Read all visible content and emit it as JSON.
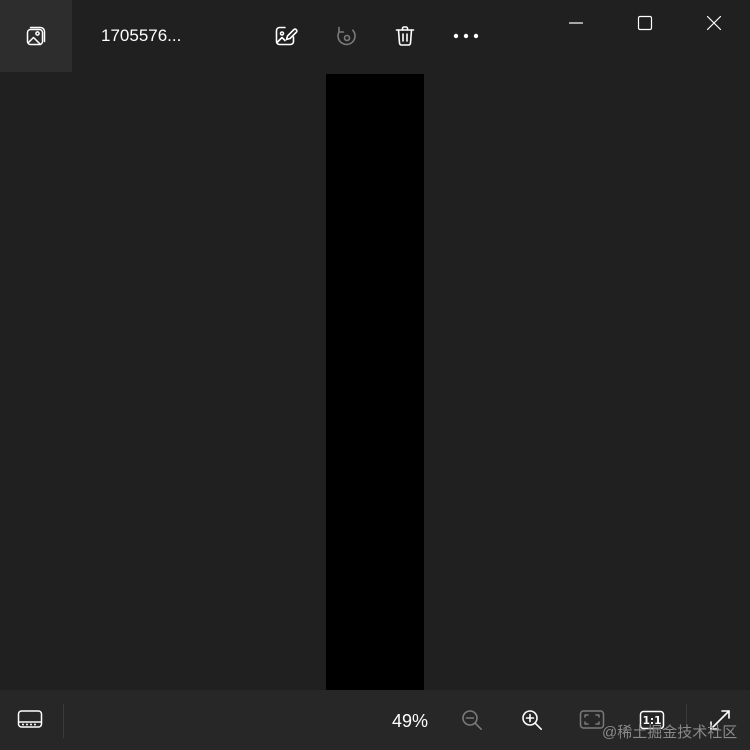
{
  "titlebar": {
    "file_name": "1705576..."
  },
  "toolbar": {
    "gallery_icon": "photo-gallery-icon",
    "edit_icon": "edit-image-icon",
    "rotate_icon": "rotate-icon",
    "delete_icon": "trash-icon",
    "more_icon": "more-options-icon"
  },
  "window_controls": {
    "minimize_icon": "minimize-icon",
    "maximize_icon": "maximize-icon",
    "close_icon": "close-icon"
  },
  "bottombar": {
    "filmstrip_icon": "filmstrip-icon",
    "zoom_level": "49%",
    "zoom_out_icon": "zoom-out-icon",
    "zoom_in_icon": "zoom-in-icon",
    "fit_icon": "fit-to-window-icon",
    "actual_size_label": "1:1",
    "fullscreen_icon": "fullscreen-expand-icon"
  },
  "watermark": {
    "text": "@稀土掘金技术社区"
  },
  "colors": {
    "background": "#202020",
    "bottombar": "#272727",
    "icon": "#ffffff",
    "icon_disabled": "#7a7a7a"
  }
}
